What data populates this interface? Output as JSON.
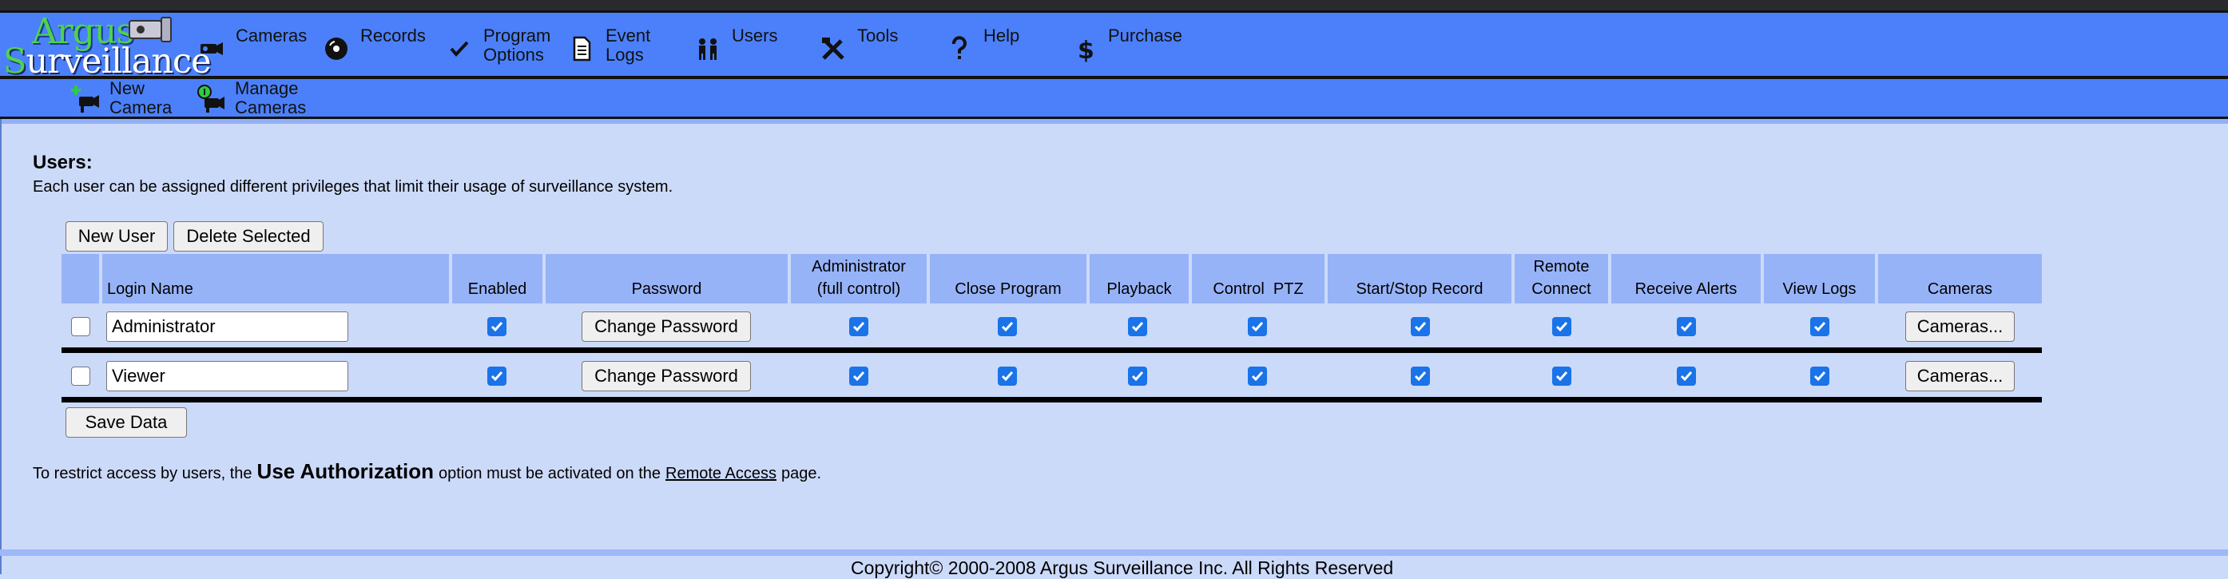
{
  "logo": {
    "line1": "Argus",
    "line2_cap": "S",
    "line2": "urveillance"
  },
  "nav": {
    "cameras": "Cameras",
    "records": "Records",
    "program_options": "Program\nOptions",
    "event_logs": "Event\nLogs",
    "users": "Users",
    "tools": "Tools",
    "help": "Help",
    "purchase": "Purchase"
  },
  "subnav": {
    "new_camera": "New\nCamera",
    "manage_cameras": "Manage\nCameras"
  },
  "page": {
    "title": "Users:",
    "description": "Each user can be assigned different privileges that limit their usage of surveillance system."
  },
  "buttons": {
    "new_user": "New User",
    "delete_selected": "Delete Selected",
    "save_data": "Save Data",
    "change_password": "Change Password",
    "cameras": "Cameras..."
  },
  "table": {
    "headers": {
      "login_name": "Login Name",
      "enabled": "Enabled",
      "password": "Password",
      "administrator": "Administrator\n(full control)",
      "close_program": "Close Program",
      "playback": "Playback",
      "control_ptz": "Control  PTZ",
      "start_stop_record": "Start/Stop Record",
      "remote_connect": "Remote\nConnect",
      "receive_alerts": "Receive Alerts",
      "view_logs": "View Logs",
      "cameras": "Cameras"
    },
    "rows": [
      {
        "login": "Administrator",
        "selected": false,
        "enabled": true,
        "administrator": true,
        "close_program": true,
        "playback": true,
        "control_ptz": true,
        "start_stop_record": true,
        "remote_connect": true,
        "receive_alerts": true,
        "view_logs": true
      },
      {
        "login": "Viewer",
        "selected": false,
        "enabled": true,
        "administrator": true,
        "close_program": true,
        "playback": true,
        "control_ptz": true,
        "start_stop_record": true,
        "remote_connect": true,
        "receive_alerts": true,
        "view_logs": true
      }
    ]
  },
  "footnote": {
    "part1": "To restrict access by users, the",
    "emphasis": "Use Authorization",
    "part2": "option must be activated on the",
    "link": "Remote Access",
    "part3": "page."
  },
  "copyright": "Copyright© 2000-2008 Argus Surveillance Inc. All Rights Reserved",
  "colors": {
    "nav_blue": "#4b80fa",
    "page_bg": "#ccdaf9",
    "header_bg": "#97b3f8",
    "checkbox_blue": "#1a73e8"
  }
}
